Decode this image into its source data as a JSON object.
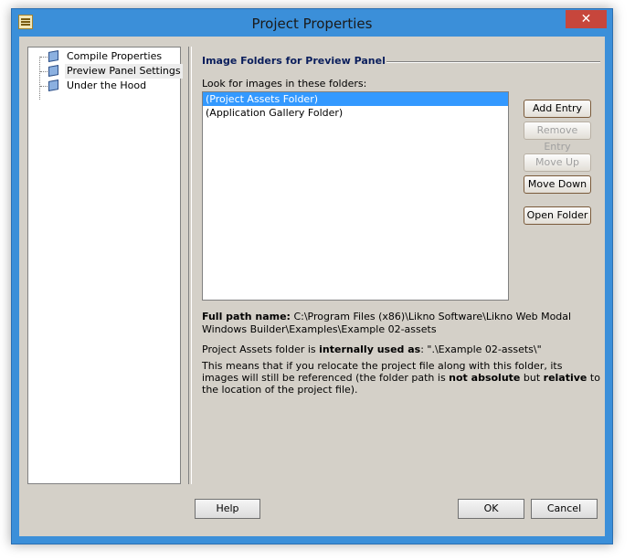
{
  "window": {
    "title": "Project Properties",
    "close_glyph": "✕"
  },
  "tree": {
    "items": [
      {
        "label": "Compile Properties",
        "icon": "cube-icon"
      },
      {
        "label": "Preview Panel Settings",
        "icon": "cube-icon",
        "selected": true
      },
      {
        "label": "Under the Hood",
        "icon": "cube-icon"
      }
    ]
  },
  "panel": {
    "section_title": "Image Folders for Preview Panel",
    "folders_label": "Look for images in these folders:",
    "folders": [
      {
        "label": "(Project Assets Folder)",
        "selected": true
      },
      {
        "label": "(Application Gallery Folder)"
      }
    ],
    "buttons": {
      "add_entry": "Add Entry",
      "remove_entry": "Remove Entry",
      "move_up": "Move Up",
      "move_down": "Move Down",
      "open_folder": "Open Folder"
    },
    "full_path_label": "Full path name:",
    "full_path_value": "C:\\Program Files (x86)\\Likno Software\\Likno Web Modal Windows Builder\\Examples\\Example 02-assets",
    "used_as_prefix": "Project Assets folder is",
    "used_as_bold": "internally used as",
    "used_as_value": ": \".\\Example 02-assets\\\"",
    "relocate_1": "This means that if you relocate the project file along with this folder, its images will still be referenced (the folder path is",
    "relocate_bold1": "not absolute",
    "relocate_2": "but",
    "relocate_bold2": "relative",
    "relocate_3": "to the location of the project file)."
  },
  "footer": {
    "help": "Help",
    "ok": "OK",
    "cancel": "Cancel"
  },
  "colors": {
    "titlebar": "#3b8fd9",
    "close": "#c7463c",
    "client": "#d4d0c8",
    "selection": "#3399ff",
    "section_title": "#0a1e5c"
  }
}
